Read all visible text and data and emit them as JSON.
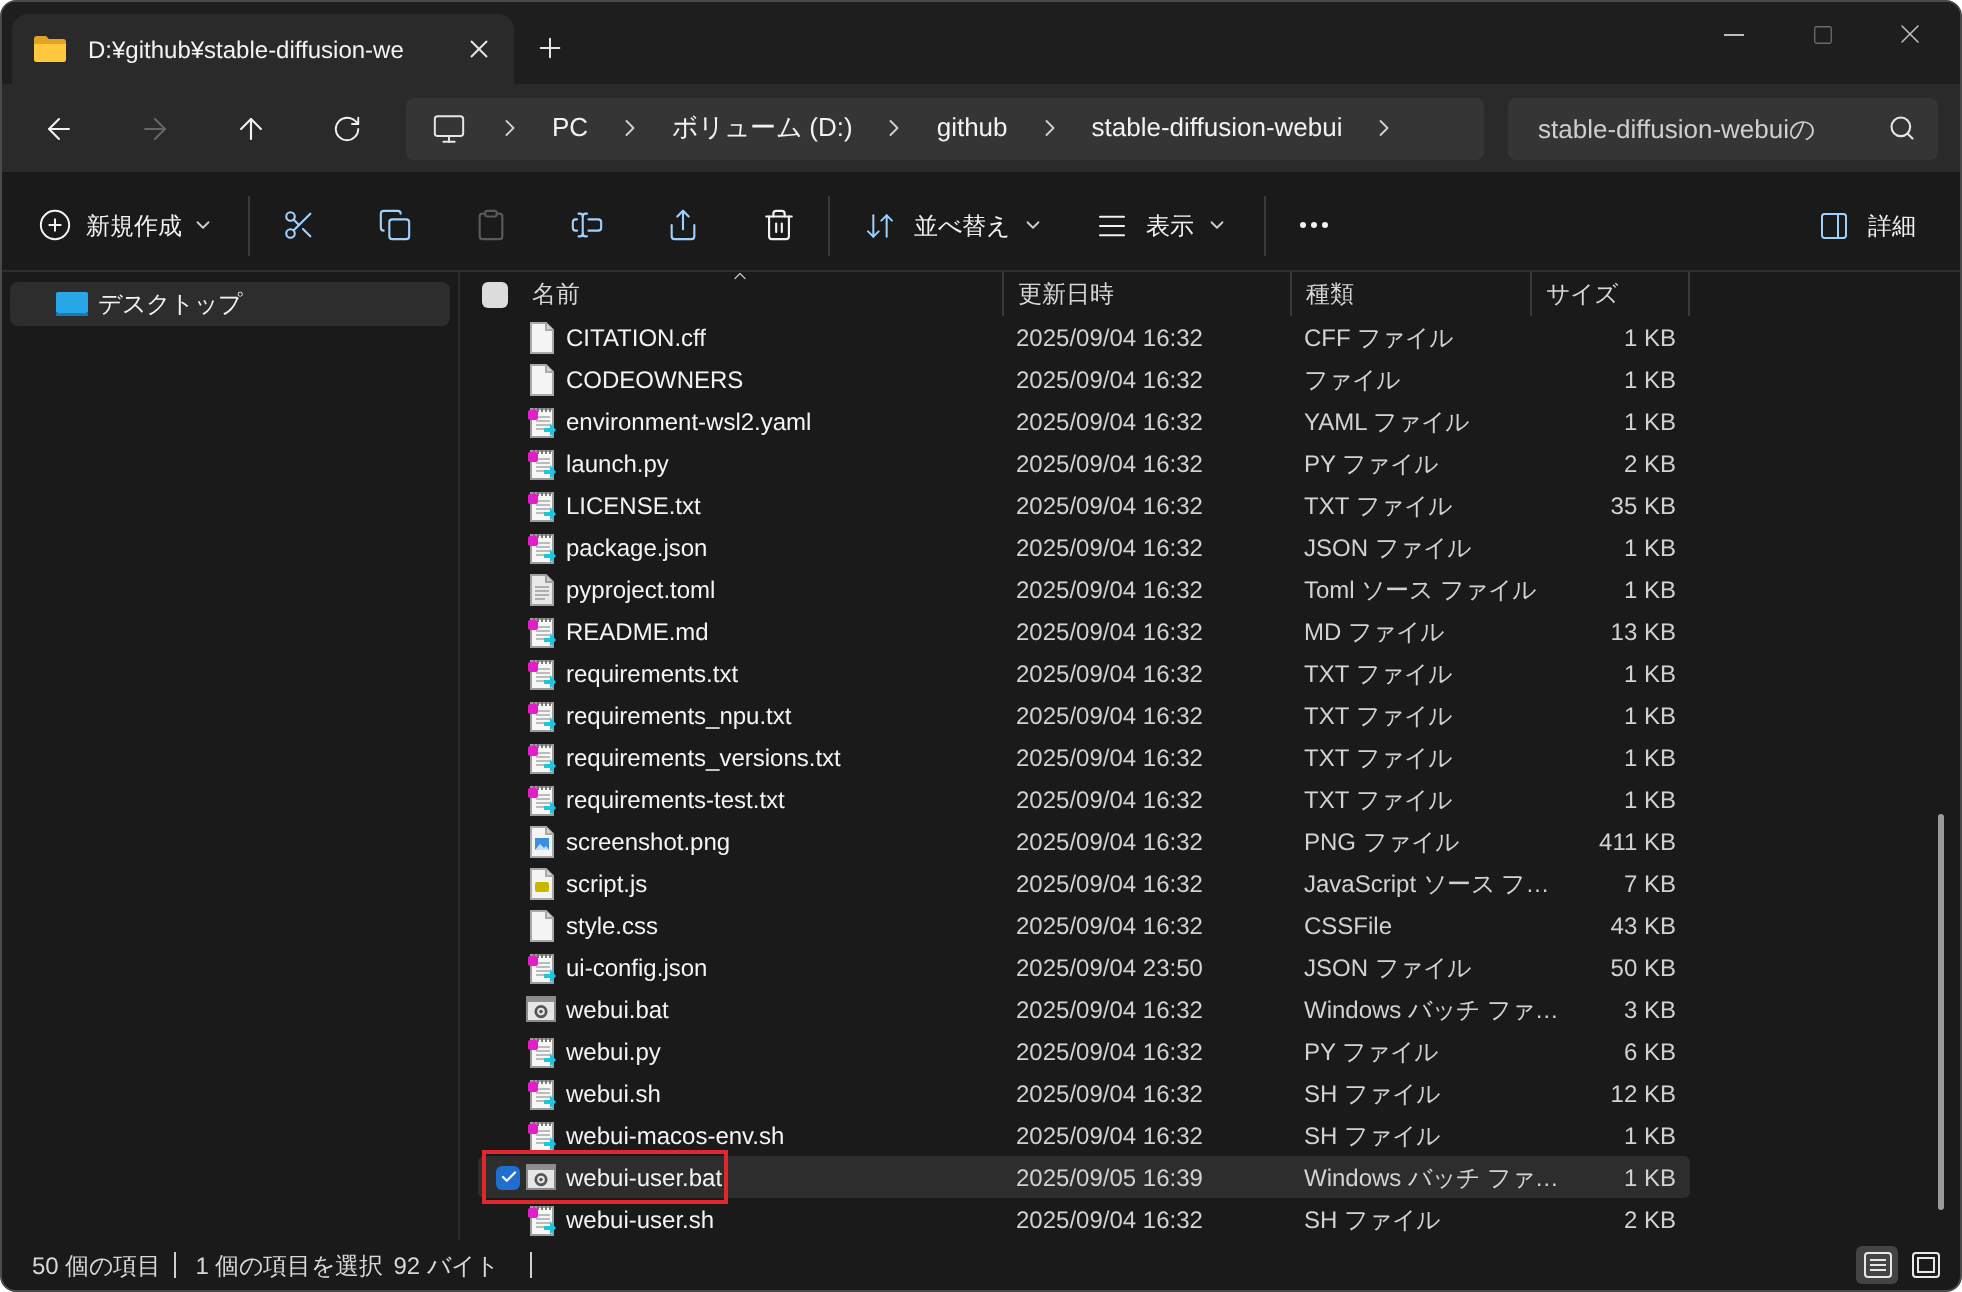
{
  "window": {
    "tab": {
      "title": "D:¥github¥stable-diffusion-we"
    }
  },
  "navigation": {
    "back": {
      "disabled": false
    },
    "forward": {
      "disabled": true
    },
    "up": {
      "disabled": false
    },
    "refresh": {
      "disabled": false
    }
  },
  "address_bar": {
    "segments": [
      "PC",
      "ボリューム (D:)",
      "github",
      "stable-diffusion-webui"
    ]
  },
  "search": {
    "placeholder": "stable-diffusion-webuiの"
  },
  "toolbar": {
    "new": {
      "label": "新規作成"
    },
    "cut": {
      "disabled": false
    },
    "copy": {
      "disabled": false
    },
    "paste": {
      "disabled": true
    },
    "rename": {
      "disabled": false
    },
    "share": {
      "disabled": false
    },
    "delete": {
      "disabled": false
    },
    "sort": {
      "label": "並べ替え"
    },
    "view": {
      "label": "表示"
    },
    "details": {
      "label": "詳細"
    }
  },
  "sidebar": {
    "items": [
      {
        "label": "デスクトップ",
        "selected": true
      }
    ]
  },
  "table": {
    "select_all": {
      "checked": false
    },
    "columns": [
      {
        "label": "名前",
        "sorted": true
      },
      {
        "label": "更新日時",
        "sorted": false
      },
      {
        "label": "種類",
        "sorted": false
      },
      {
        "label": "サイズ",
        "sorted": false
      }
    ],
    "rows": [
      {
        "kind": "blank",
        "name": "CITATION.cff",
        "modified": "2025/09/04 16:32",
        "type": "CFF ファイル",
        "size": "1 KB",
        "selected": false,
        "highlighted": false
      },
      {
        "kind": "blank",
        "name": "CODEOWNERS",
        "modified": "2025/09/04 16:32",
        "type": "ファイル",
        "size": "1 KB",
        "selected": false,
        "highlighted": false
      },
      {
        "kind": "editor",
        "name": "environment-wsl2.yaml",
        "modified": "2025/09/04 16:32",
        "type": "YAML ファイル",
        "size": "1 KB",
        "selected": false,
        "highlighted": false
      },
      {
        "kind": "editor",
        "name": "launch.py",
        "modified": "2025/09/04 16:32",
        "type": "PY ファイル",
        "size": "2 KB",
        "selected": false,
        "highlighted": false
      },
      {
        "kind": "editor",
        "name": "LICENSE.txt",
        "modified": "2025/09/04 16:32",
        "type": "TXT ファイル",
        "size": "35 KB",
        "selected": false,
        "highlighted": false
      },
      {
        "kind": "editor",
        "name": "package.json",
        "modified": "2025/09/04 16:32",
        "type": "JSON ファイル",
        "size": "1 KB",
        "selected": false,
        "highlighted": false
      },
      {
        "kind": "text",
        "name": "pyproject.toml",
        "modified": "2025/09/04 16:32",
        "type": "Toml ソース ファイル",
        "size": "1 KB",
        "selected": false,
        "highlighted": false
      },
      {
        "kind": "editor",
        "name": "README.md",
        "modified": "2025/09/04 16:32",
        "type": "MD ファイル",
        "size": "13 KB",
        "selected": false,
        "highlighted": false
      },
      {
        "kind": "editor",
        "name": "requirements.txt",
        "modified": "2025/09/04 16:32",
        "type": "TXT ファイル",
        "size": "1 KB",
        "selected": false,
        "highlighted": false
      },
      {
        "kind": "editor",
        "name": "requirements_npu.txt",
        "modified": "2025/09/04 16:32",
        "type": "TXT ファイル",
        "size": "1 KB",
        "selected": false,
        "highlighted": false
      },
      {
        "kind": "editor",
        "name": "requirements_versions.txt",
        "modified": "2025/09/04 16:32",
        "type": "TXT ファイル",
        "size": "1 KB",
        "selected": false,
        "highlighted": false
      },
      {
        "kind": "editor",
        "name": "requirements-test.txt",
        "modified": "2025/09/04 16:32",
        "type": "TXT ファイル",
        "size": "1 KB",
        "selected": false,
        "highlighted": false
      },
      {
        "kind": "image",
        "name": "screenshot.png",
        "modified": "2025/09/04 16:32",
        "type": "PNG ファイル",
        "size": "411 KB",
        "selected": false,
        "highlighted": false
      },
      {
        "kind": "js",
        "name": "script.js",
        "modified": "2025/09/04 16:32",
        "type": "JavaScript ソース フ…",
        "size": "7 KB",
        "selected": false,
        "highlighted": false
      },
      {
        "kind": "blank",
        "name": "style.css",
        "modified": "2025/09/04 16:32",
        "type": "CSSFile",
        "size": "43 KB",
        "selected": false,
        "highlighted": false
      },
      {
        "kind": "editor",
        "name": "ui-config.json",
        "modified": "2025/09/04 23:50",
        "type": "JSON ファイル",
        "size": "50 KB",
        "selected": false,
        "highlighted": false
      },
      {
        "kind": "batch",
        "name": "webui.bat",
        "modified": "2025/09/04 16:32",
        "type": "Windows バッチ ファ…",
        "size": "3 KB",
        "selected": false,
        "highlighted": false
      },
      {
        "kind": "editor",
        "name": "webui.py",
        "modified": "2025/09/04 16:32",
        "type": "PY ファイル",
        "size": "6 KB",
        "selected": false,
        "highlighted": false
      },
      {
        "kind": "editor",
        "name": "webui.sh",
        "modified": "2025/09/04 16:32",
        "type": "SH ファイル",
        "size": "12 KB",
        "selected": false,
        "highlighted": false
      },
      {
        "kind": "editor",
        "name": "webui-macos-env.sh",
        "modified": "2025/09/04 16:32",
        "type": "SH ファイル",
        "size": "1 KB",
        "selected": false,
        "highlighted": false
      },
      {
        "kind": "batch",
        "name": "webui-user.bat",
        "modified": "2025/09/05 16:39",
        "type": "Windows バッチ ファ…",
        "size": "1 KB",
        "selected": true,
        "highlighted": true
      },
      {
        "kind": "editor",
        "name": "webui-user.sh",
        "modified": "2025/09/04 16:32",
        "type": "SH ファイル",
        "size": "2 KB",
        "selected": false,
        "highlighted": false
      }
    ]
  },
  "status_bar": {
    "item_count": "50 個の項目",
    "selection": "1 個の項目を選択",
    "selection_size": "92 バイト",
    "view_buttons": [
      {
        "kind": "details",
        "selected": true
      },
      {
        "kind": "tiles",
        "selected": false
      }
    ]
  }
}
